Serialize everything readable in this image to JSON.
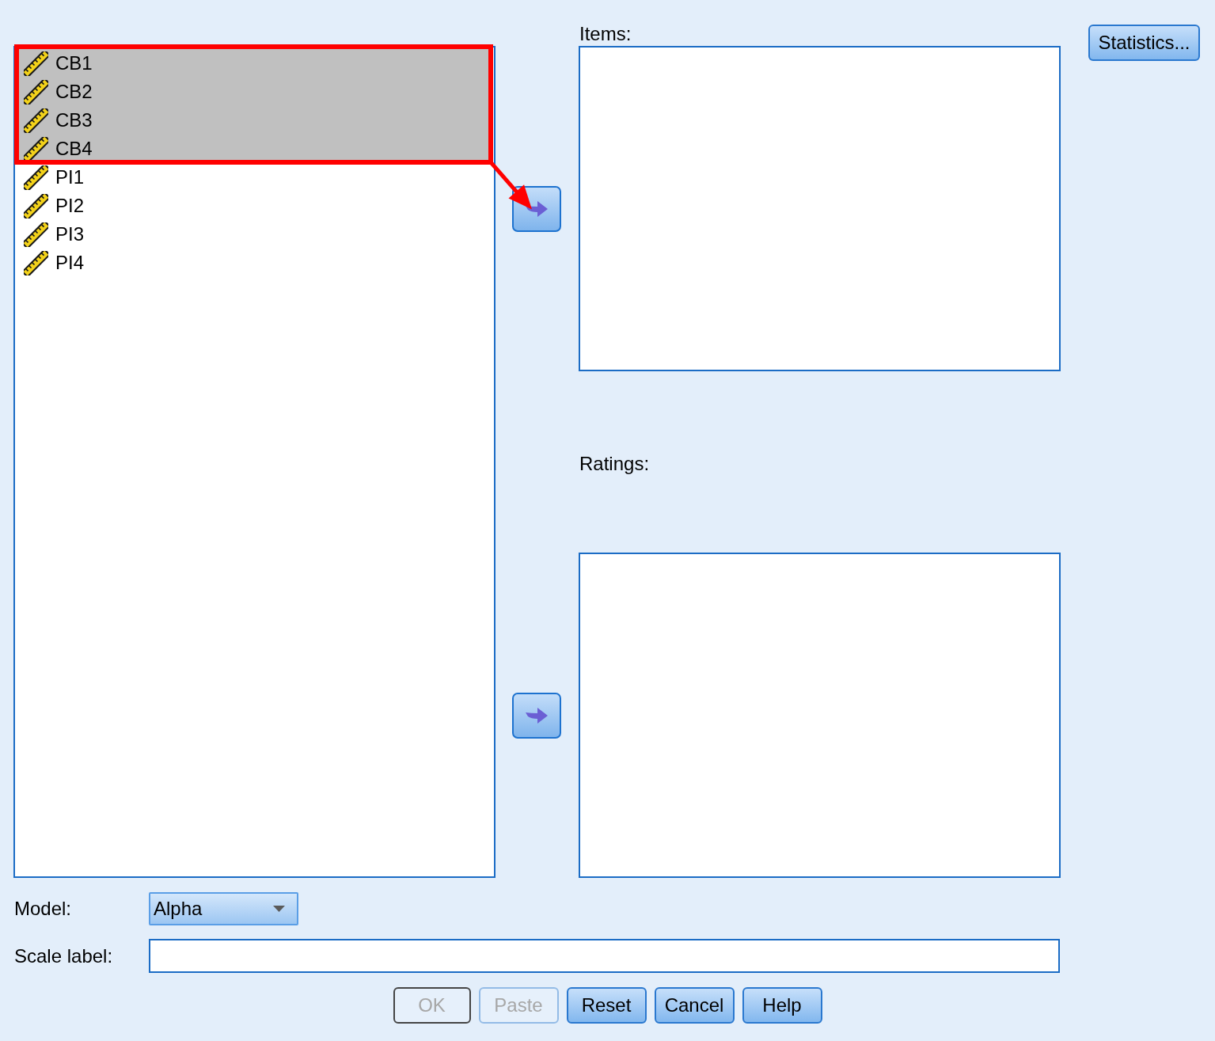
{
  "source_list": {
    "items": [
      {
        "label": "CB1",
        "selected": true
      },
      {
        "label": "CB2",
        "selected": true
      },
      {
        "label": "CB3",
        "selected": true
      },
      {
        "label": "CB4",
        "selected": true
      },
      {
        "label": "PI1",
        "selected": false
      },
      {
        "label": "PI2",
        "selected": false
      },
      {
        "label": "PI3",
        "selected": false
      },
      {
        "label": "PI4",
        "selected": false
      }
    ]
  },
  "items_list": {
    "label": "Items:"
  },
  "statistics_button": {
    "label": "Statistics..."
  },
  "ratings_list": {
    "label": "Ratings:"
  },
  "model": {
    "label": "Model:",
    "value": "Alpha"
  },
  "scale_label": {
    "label": "Scale label:"
  },
  "buttons": [
    {
      "label": "OK",
      "disabled": true,
      "default": true
    },
    {
      "label": "Paste",
      "disabled": true,
      "default": false
    },
    {
      "label": "Reset",
      "disabled": false,
      "default": false
    },
    {
      "label": "Cancel",
      "disabled": false,
      "default": false
    },
    {
      "label": "Help",
      "disabled": false,
      "default": false
    }
  ],
  "selection_callout": {
    "frame": true,
    "arrow": true
  }
}
